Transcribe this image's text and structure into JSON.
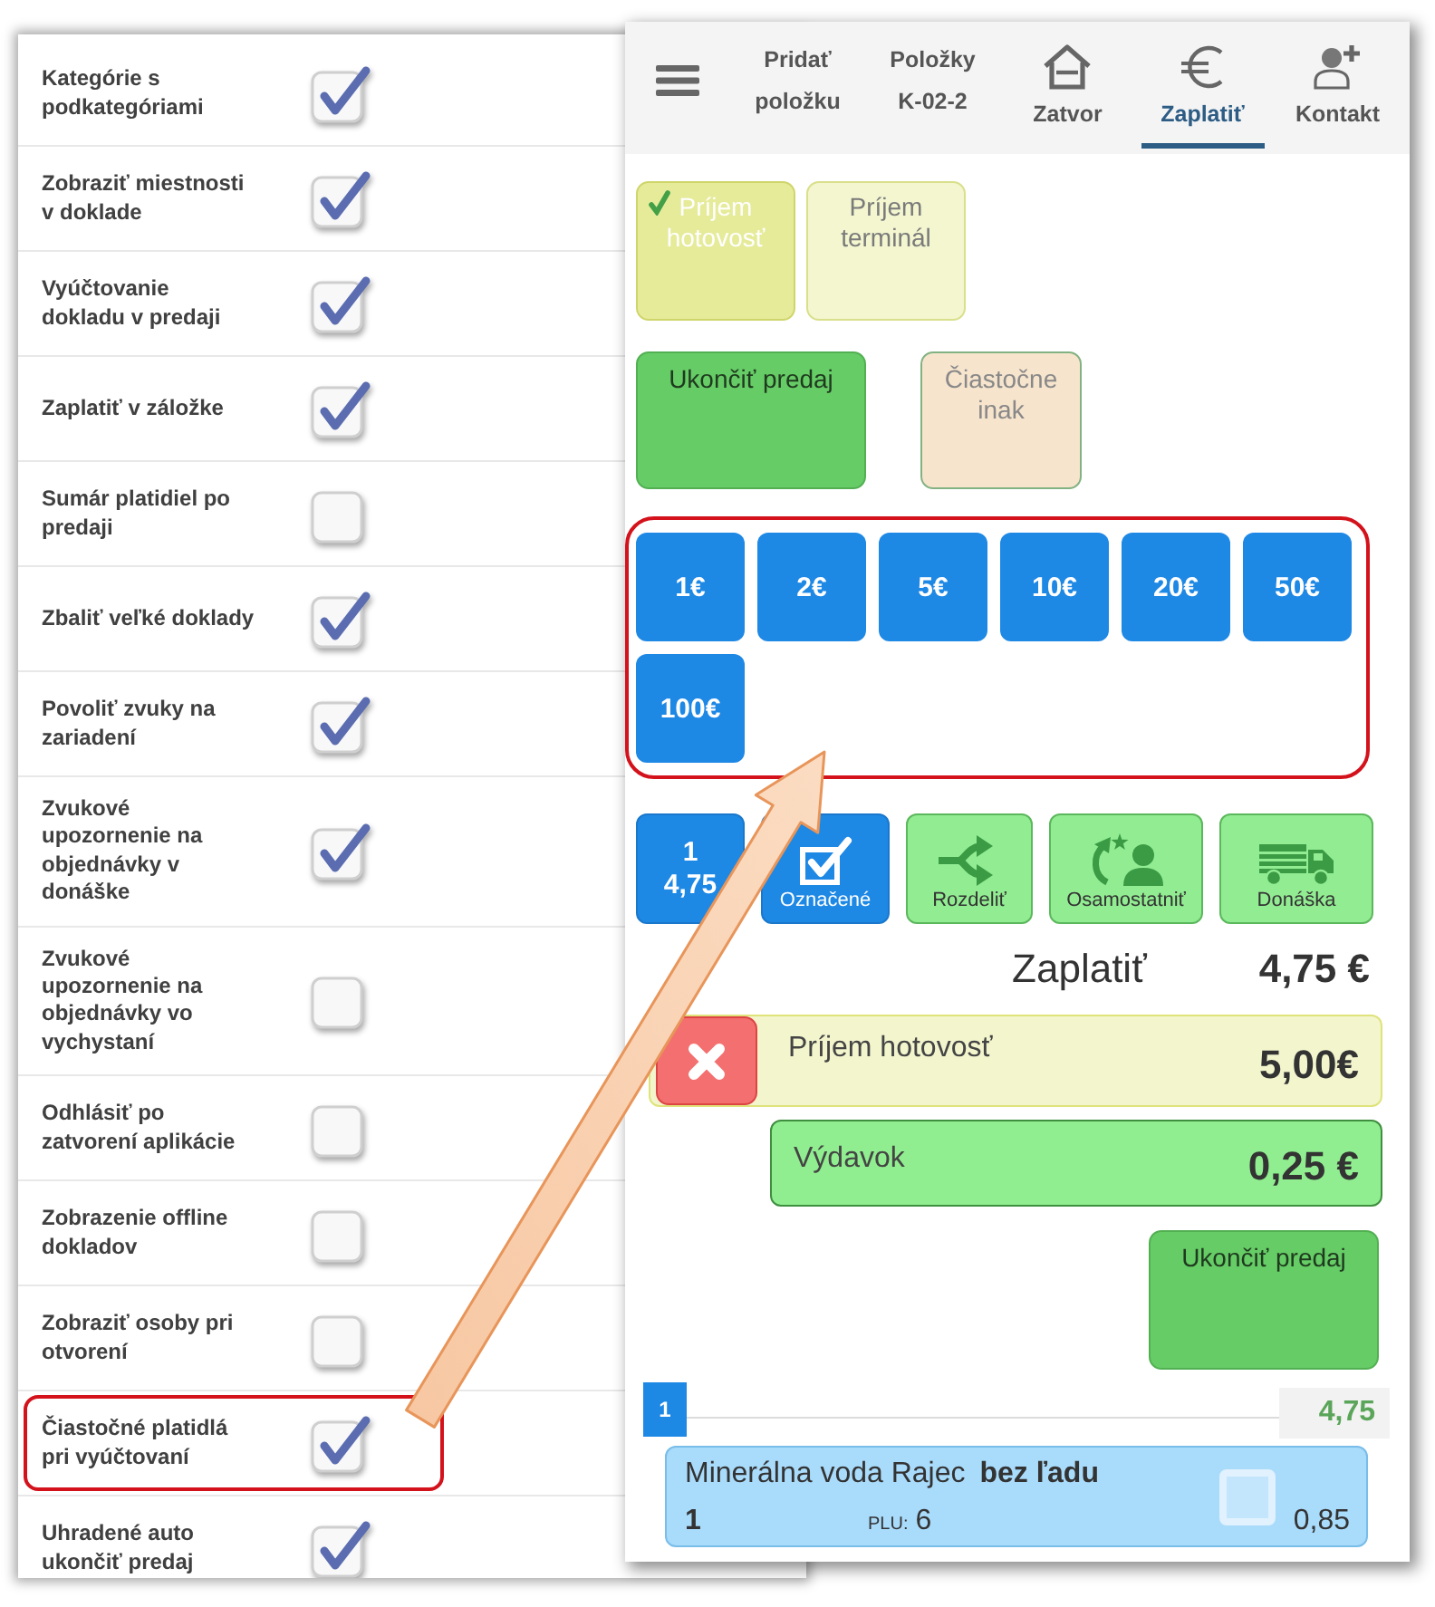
{
  "settings": {
    "options": [
      {
        "label": "Kategórie s podkategóriami",
        "checked": true,
        "highlighted": false
      },
      {
        "label": "Zobraziť miestnosti v doklade",
        "checked": true,
        "highlighted": false
      },
      {
        "label": "Vyúčtovanie dokladu v predaji",
        "checked": true,
        "highlighted": false
      },
      {
        "label": "Zaplatiť v záložke",
        "checked": true,
        "highlighted": false
      },
      {
        "label": "Sumár platidiel po predaji",
        "checked": false,
        "highlighted": false
      },
      {
        "label": "Zbaliť veľké doklady",
        "checked": true,
        "highlighted": false
      },
      {
        "label": "Povoliť zvuky na zariadení",
        "checked": true,
        "highlighted": false
      },
      {
        "label": "Zvukové upozornenie na objednávky v donáške",
        "checked": true,
        "highlighted": false
      },
      {
        "label": "Zvukové upozornenie na objednávky vo vychystaní",
        "checked": false,
        "highlighted": false
      },
      {
        "label": "Odhlásiť po zatvorení aplikácie",
        "checked": false,
        "highlighted": false
      },
      {
        "label": "Zobrazenie offline dokladov",
        "checked": false,
        "highlighted": false
      },
      {
        "label": "Zobraziť osoby pri otvorení",
        "checked": false,
        "highlighted": false
      },
      {
        "label": "Čiastočné platidlá pri vyúčtovaní",
        "checked": true,
        "highlighted": true
      },
      {
        "label": "Uhradené auto ukončiť predaj",
        "checked": true,
        "highlighted": false
      }
    ]
  },
  "payment": {
    "tabs": [
      {
        "label": "Pridať položku",
        "kind": "text",
        "selected": false
      },
      {
        "label": "Položky K-02-2",
        "kind": "text",
        "selected": false
      },
      {
        "label": "Zatvor",
        "kind": "house",
        "selected": false
      },
      {
        "label": "Zaplatiť",
        "kind": "euro",
        "selected": true
      },
      {
        "label": "Kontakt",
        "kind": "contact",
        "selected": false
      }
    ],
    "methods": [
      {
        "label": "Príjem hotovosť",
        "selected": true
      },
      {
        "label": "Príjem terminál",
        "selected": false
      }
    ],
    "actions": [
      {
        "label": "Ukončiť predaj",
        "kind": "finish"
      },
      {
        "label": "Čiastočne inak",
        "kind": "partial"
      }
    ],
    "bills": {
      "highlighted": true,
      "items": [
        "1€",
        "2€",
        "5€",
        "10€",
        "20€",
        "50€",
        "100€"
      ]
    },
    "tools": [
      {
        "kind": "count",
        "label": "1",
        "value": "4,75"
      },
      {
        "kind": "marked",
        "label": "Označené"
      },
      {
        "kind": "split",
        "label": "Rozdeliť"
      },
      {
        "kind": "separate",
        "label": "Osamostatniť"
      },
      {
        "kind": "delivery",
        "label": "Donáška"
      }
    ],
    "total": {
      "label": "Zaplatiť",
      "amount": "4,75 €"
    },
    "entries": [
      {
        "kind": "received",
        "label": "Príjem hotovosť",
        "amount": "5,00€"
      },
      {
        "kind": "change",
        "label": "Výdavok",
        "amount": "0,25 €"
      }
    ],
    "finish_button": "Ukončiť predaj",
    "group": {
      "number": "1",
      "total": "4,75"
    },
    "items": [
      {
        "name": "Minerálna voda Rajec",
        "note": "bez ľadu",
        "quantity": "1",
        "plu_label": "PLU:",
        "plu": "6",
        "price": "0,85",
        "checked": false
      }
    ]
  }
}
